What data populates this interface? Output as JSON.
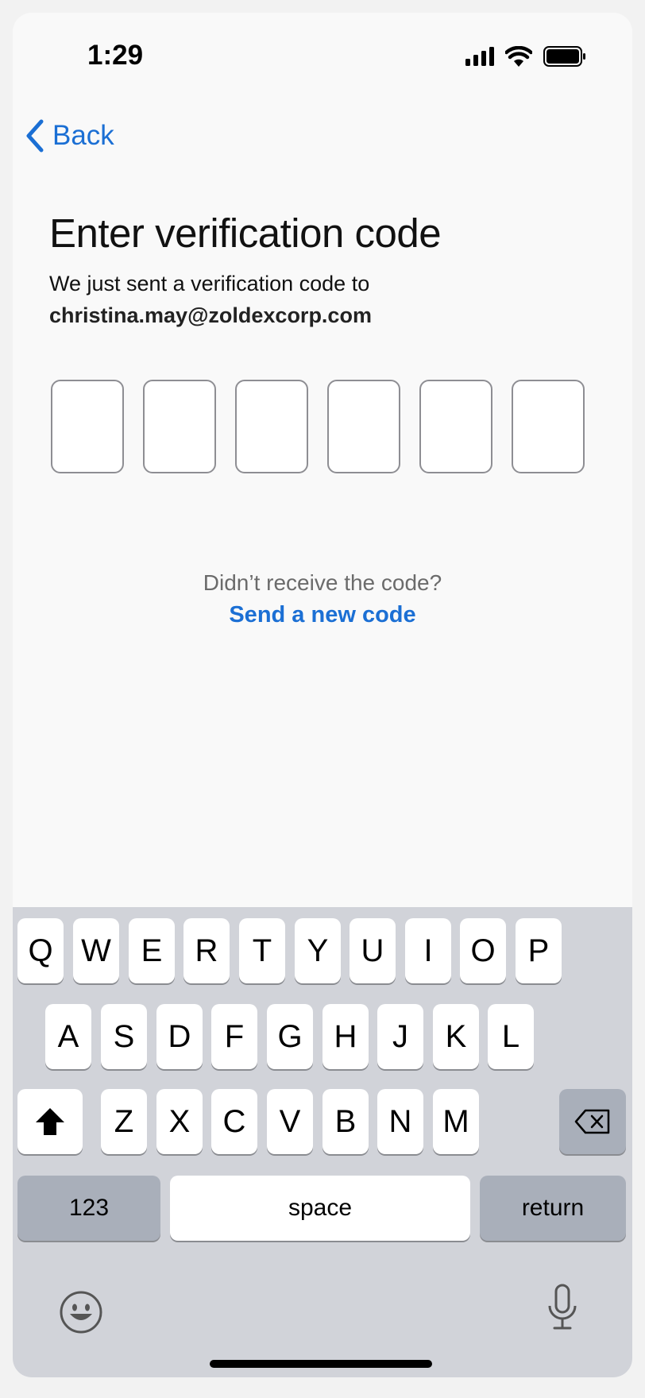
{
  "status_bar": {
    "time": "1:29"
  },
  "nav": {
    "back_label": "Back"
  },
  "screen": {
    "title": "Enter verification code",
    "subtitle": "We just sent a verification code to",
    "email": "christina.may@zoldexcorp.com",
    "code_digits": [
      "",
      "",
      "",
      "",
      "",
      ""
    ],
    "resend_question": "Didn’t receive the code?",
    "resend_link": "Send a new code"
  },
  "keyboard": {
    "row1": [
      "Q",
      "W",
      "E",
      "R",
      "T",
      "Y",
      "U",
      "I",
      "O",
      "P"
    ],
    "row2": [
      "A",
      "S",
      "D",
      "F",
      "G",
      "H",
      "J",
      "K",
      "L"
    ],
    "row3": [
      "Z",
      "X",
      "C",
      "V",
      "B",
      "N",
      "M"
    ],
    "numbers_label": "123",
    "space_label": "space",
    "return_label": "return"
  },
  "colors": {
    "accent": "#1b6fd4",
    "keyboard_bg": "#d1d3d9",
    "dark_key": "#a9afba"
  }
}
